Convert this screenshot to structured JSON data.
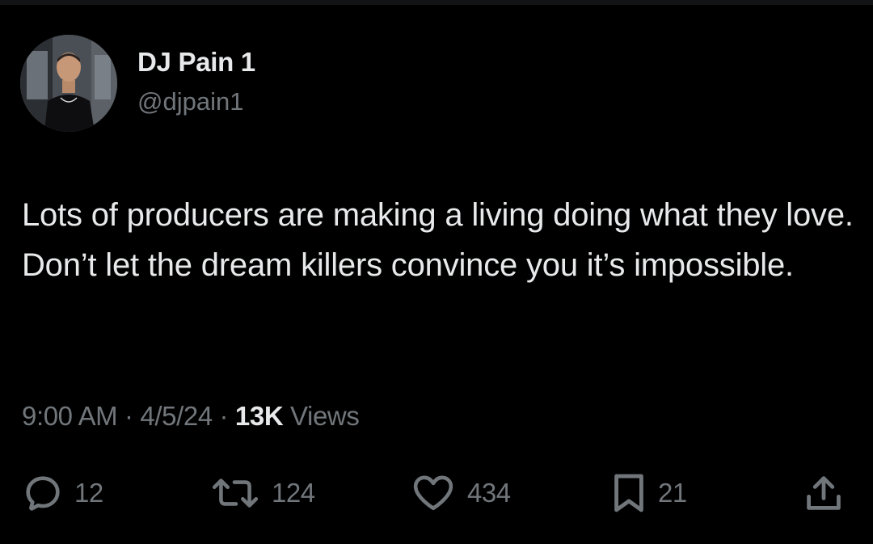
{
  "author": {
    "display_name": "DJ Pain 1",
    "handle": "@djpain1"
  },
  "tweet": {
    "text": "Lots of producers are making a living doing what they love. Don’t let the dream killers convince you it’s impossible."
  },
  "meta": {
    "time": "9:00 AM",
    "separator": " · ",
    "date": "4/5/24",
    "views_count": "13K",
    "views_label": " Views"
  },
  "actions": {
    "replies": "12",
    "reposts": "124",
    "likes": "434",
    "bookmarks": "21"
  },
  "icons": {
    "reply": "reply-icon",
    "repost": "repost-icon",
    "like": "heart-icon",
    "bookmark": "bookmark-icon",
    "share": "share-icon"
  },
  "colors": {
    "background": "#000000",
    "primary_text": "#e7e9ea",
    "secondary_text": "#71767b"
  }
}
